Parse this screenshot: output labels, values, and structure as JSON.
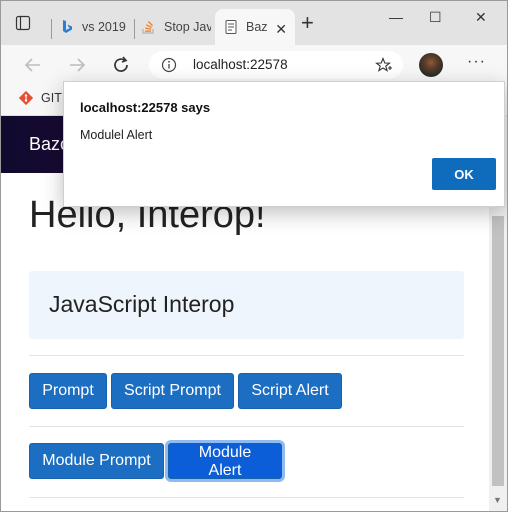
{
  "browser": {
    "tabs": [
      {
        "label": "vs 2019",
        "icon": "bing-icon"
      },
      {
        "label": "Stop Jav",
        "icon": "stackoverflow-icon"
      },
      {
        "label": "Baz",
        "icon": "page-icon",
        "active": true
      }
    ],
    "window_controls": {
      "minimize": "—",
      "maximize": "☐",
      "close": "✕"
    },
    "new_tab": "+",
    "close_tab": "✕",
    "url": "localhost:22578",
    "more": "···",
    "bookmark": {
      "label": "GIT",
      "icon": "git-icon"
    }
  },
  "page": {
    "brand": "Bazo",
    "hello": "Hello, Interop!",
    "panel_title": "JavaScript Interop",
    "buttons_row1": {
      "prompt": "Prompt",
      "script_prompt": "Script Prompt",
      "script_alert": "Script Alert"
    },
    "buttons_row2": {
      "module_prompt": "Module Prompt",
      "module_alert": "Module Alert"
    }
  },
  "dialog": {
    "title": "localhost:22578 says",
    "message": "Modulel Alert",
    "ok": "OK"
  },
  "colors": {
    "accent": "#1b6ec2",
    "dialog_ok": "#0f6cbd",
    "header_gradient_start": "#0f0a2e",
    "header_gradient_end": "#3a0a48"
  }
}
